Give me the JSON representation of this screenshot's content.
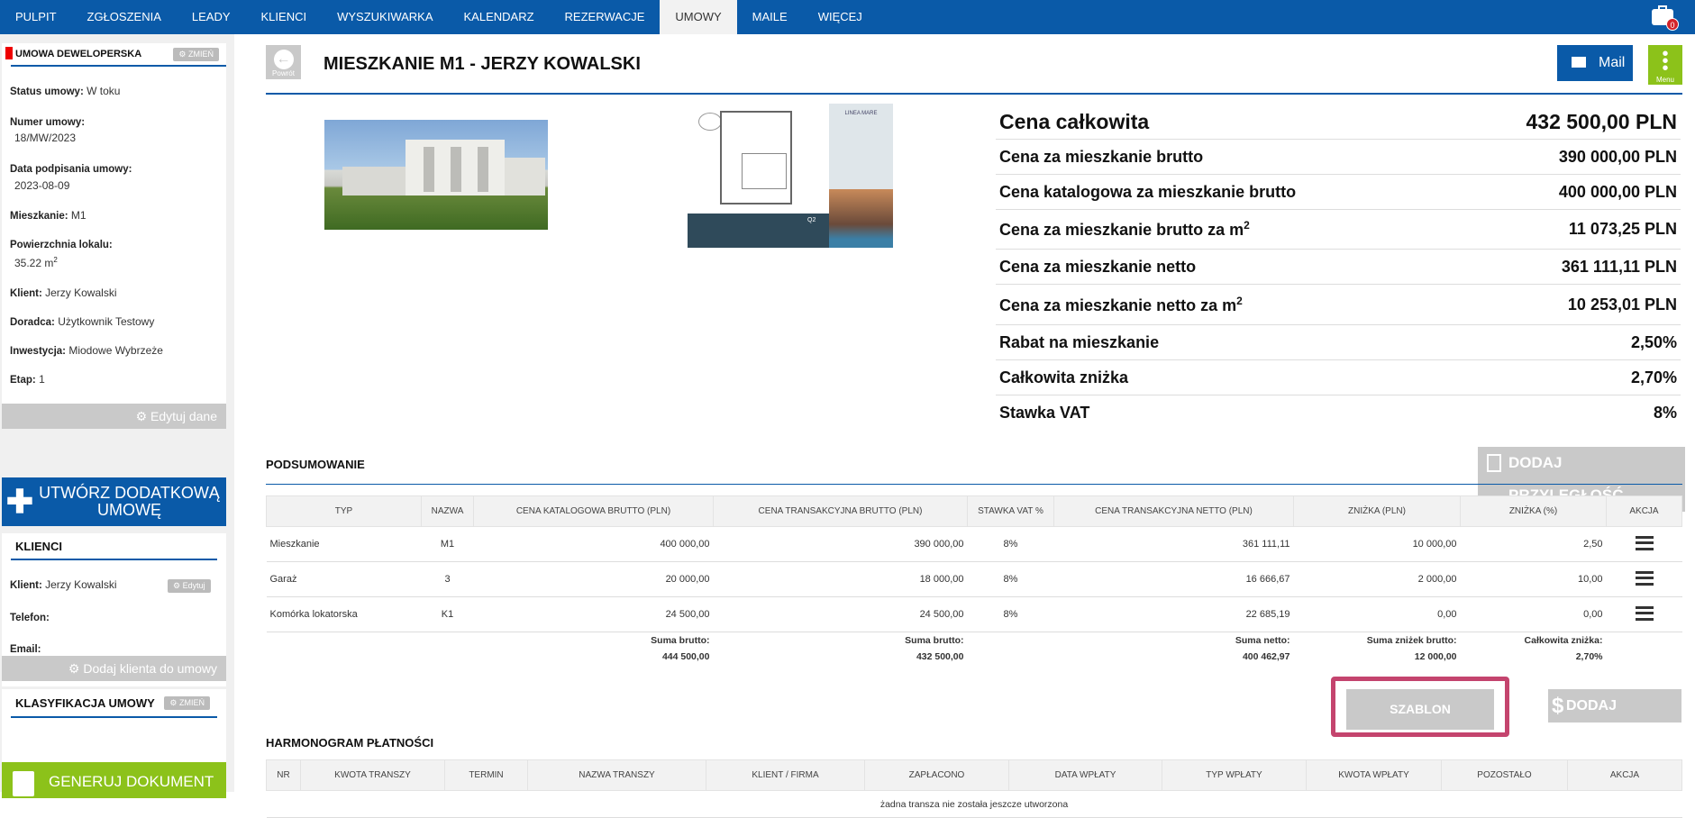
{
  "nav": {
    "items": [
      "PULPIT",
      "ZGŁOSZENIA",
      "LEADY",
      "KLIENCI",
      "WYSZUKIWARKA",
      "KALENDARZ",
      "REZERWACJE",
      "UMOWY",
      "MAILE",
      "WIĘCEJ"
    ],
    "active": "UMOWY",
    "badge_count": "0"
  },
  "sidebar": {
    "contract": {
      "title": "UMOWA DEWELOPERSKA",
      "change_label": "ZMIEŃ",
      "status_label": "Status umowy:",
      "status_value": "W toku",
      "number_label": "Numer umowy:",
      "number_value": "18/MW/2023",
      "signed_label": "Data podpisania umowy:",
      "signed_value": "2023-08-09",
      "apartment_label": "Mieszkanie:",
      "apartment_value": "M1",
      "area_label": "Powierzchnia lokalu:",
      "area_value": "35.22 m",
      "area_unit_sup": "2",
      "client_label": "Klient:",
      "client_value": "Jerzy Kowalski",
      "advisor_label": "Doradca:",
      "advisor_value": "Użytkownik Testowy",
      "investment_label": "Inwestycja:",
      "investment_value": "Miodowe Wybrzeże",
      "stage_label": "Etap:",
      "stage_value": "1",
      "edit_label": "Edytuj dane"
    },
    "create_additional_label": "UTWÓRZ DODATKOWĄ UMOWĘ",
    "clients": {
      "title": "KLIENCI",
      "client_label": "Klient:",
      "client_value": "Jerzy Kowalski",
      "edit_label": "Edytuj",
      "phone_label": "Telefon:",
      "email_label": "Email:",
      "add_client_label": "Dodaj klienta do umowy"
    },
    "classification": {
      "title": "KLASYFIKACJA UMOWY",
      "change_label": "ZMIEŃ"
    },
    "generate_label": "GENERUJ DOKUMENT"
  },
  "header": {
    "back_label": "Powrót",
    "title": "MIESZKANIE M1 - JERZY KOWALSKI",
    "mail_label": "Mail",
    "menu_label": "Menu"
  },
  "plan_card": {
    "brand": "LINEA MARE",
    "unit": "Q2"
  },
  "prices": [
    {
      "label": "Cena całkowita",
      "value": "432 500,00 PLN",
      "sup": ""
    },
    {
      "label": "Cena za mieszkanie brutto",
      "value": "390 000,00 PLN",
      "sup": ""
    },
    {
      "label": "Cena katalogowa za mieszkanie brutto",
      "value": "400 000,00 PLN",
      "sup": ""
    },
    {
      "label": "Cena za mieszkanie brutto za m",
      "value": "11 073,25 PLN",
      "sup": "2"
    },
    {
      "label": "Cena za mieszkanie netto",
      "value": "361 111,11 PLN",
      "sup": ""
    },
    {
      "label": "Cena za mieszkanie netto za m",
      "value": "10 253,01 PLN",
      "sup": "2"
    },
    {
      "label": "Rabat na mieszkanie",
      "value": "2,50%",
      "sup": ""
    },
    {
      "label": "Całkowita zniżka",
      "value": "2,70%",
      "sup": ""
    },
    {
      "label": "Stawka VAT",
      "value": "8%",
      "sup": ""
    }
  ],
  "summary": {
    "title": "PODSUMOWANIE",
    "add_label": "DODAJ PRZYLEGŁOŚĆ",
    "columns": [
      "TYP",
      "NAZWA",
      "CENA KATALOGOWA BRUTTO (PLN)",
      "CENA TRANSAKCYJNA BRUTTO (PLN)",
      "STAWKA VAT %",
      "CENA TRANSAKCYJNA NETTO (PLN)",
      "ZNIŻKA (PLN)",
      "ZNIŻKA (%)",
      "AKCJA"
    ],
    "rows": [
      [
        "Mieszkanie",
        "M1",
        "400 000,00",
        "390 000,00",
        "8%",
        "361 111,11",
        "10 000,00",
        "2,50"
      ],
      [
        "Garaż",
        "3",
        "20 000,00",
        "18 000,00",
        "8%",
        "16 666,67",
        "2 000,00",
        "10,00"
      ],
      [
        "Komórka lokatorska",
        "K1",
        "24 500,00",
        "24 500,00",
        "8%",
        "22 685,19",
        "0,00",
        "0,00"
      ]
    ],
    "totals": {
      "gross_label": "Suma brutto:",
      "gross_catalog": "444 500,00",
      "gross_trans_label": "Suma brutto:",
      "gross_trans": "432 500,00",
      "net_label": "Suma netto:",
      "net": "400 462,97",
      "disc_label": "Suma zniżek brutto:",
      "disc": "12 000,00",
      "total_disc_label": "Całkowita zniżka:",
      "total_disc": "2,70%"
    }
  },
  "schedule": {
    "title": "HARMONOGRAM PŁATNOŚCI",
    "template_label": "SZABLON HARMONOGRAMU",
    "add_label": "DODAJ TRANSZĘ",
    "columns": [
      "NR",
      "KWOTA TRANSZY",
      "TERMIN",
      "NAZWA TRANSZY",
      "KLIENT / FIRMA",
      "ZAPŁACONO",
      "DATA WPŁATY",
      "TYP WPŁATY",
      "KWOTA WPŁATY",
      "POZOSTAŁO",
      "AKCJA"
    ],
    "empty_text": "żadna transza nie została jeszcze utworzona"
  },
  "colors": {
    "primary": "#0a5aa8",
    "green": "#8cc21a",
    "grey": "#c9c9c9",
    "highlight": "#c4446e"
  }
}
